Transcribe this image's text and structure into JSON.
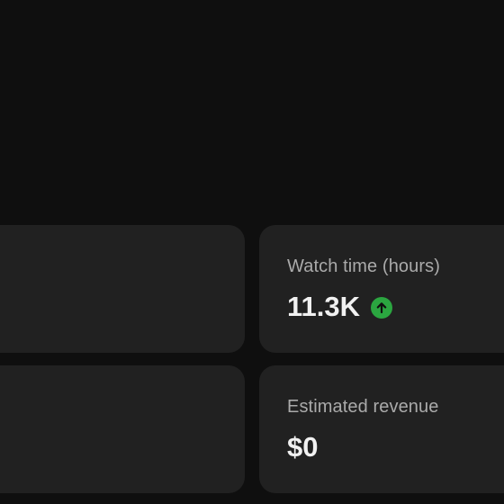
{
  "metrics": {
    "watch_time": {
      "label": "Watch time (hours)",
      "value": "11.3K",
      "trend": "up",
      "trend_icon": "arrow-up-circle-icon",
      "trend_color": "#2ba640"
    },
    "revenue": {
      "label": "Estimated revenue",
      "value": "$0"
    }
  },
  "colors": {
    "background": "#0f0f0f",
    "card": "#212121",
    "label": "#aaaaaa",
    "value": "#f1f1f1"
  }
}
